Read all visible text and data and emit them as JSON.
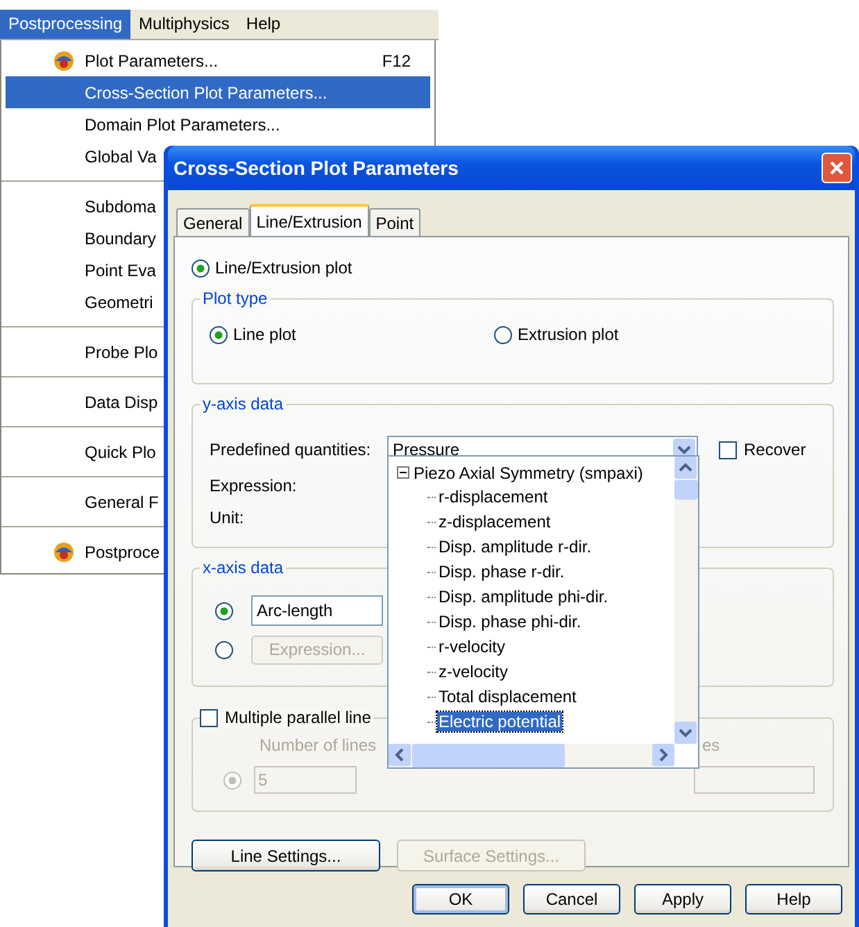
{
  "menu_bar": [
    {
      "label": "Postprocessing",
      "selected": true
    },
    {
      "label": "Multiphysics",
      "selected": false
    },
    {
      "label": "Help",
      "selected": false
    }
  ],
  "menu": [
    {
      "kind": "icon_item",
      "label": "Plot Parameters...",
      "shortcut": "F12",
      "selected": false
    },
    {
      "kind": "item",
      "label": "Cross-Section Plot Parameters...",
      "selected": true
    },
    {
      "kind": "item",
      "label": "Domain Plot Parameters...",
      "selected": false
    },
    {
      "kind": "item",
      "label": "Global Va",
      "selected": false
    },
    {
      "kind": "separator"
    },
    {
      "kind": "item",
      "label": "Subdoma",
      "selected": false
    },
    {
      "kind": "item",
      "label": "Boundary",
      "selected": false
    },
    {
      "kind": "item",
      "label": "Point Eva",
      "selected": false
    },
    {
      "kind": "item",
      "label": "Geometri",
      "selected": false
    },
    {
      "kind": "separator"
    },
    {
      "kind": "item",
      "label": "Probe Plo",
      "selected": false
    },
    {
      "kind": "separator"
    },
    {
      "kind": "item",
      "label": "Data Disp",
      "selected": false
    },
    {
      "kind": "separator"
    },
    {
      "kind": "item",
      "label": "Quick Plo",
      "selected": false
    },
    {
      "kind": "separator"
    },
    {
      "kind": "item",
      "label": "General F",
      "selected": false
    },
    {
      "kind": "separator"
    },
    {
      "kind": "icon_item",
      "label": "Postproce",
      "selected": false
    }
  ],
  "dialog": {
    "title": "Cross-Section Plot Parameters",
    "tabs": [
      {
        "label": "General",
        "selected": false
      },
      {
        "label": "Line/Extrusion",
        "selected": true
      },
      {
        "label": "Point",
        "selected": false
      }
    ],
    "mode": {
      "label": "Line/Extrusion plot",
      "selected": true
    },
    "plot_type": {
      "title": "Plot type",
      "options": [
        {
          "label": "Line plot",
          "selected": true
        },
        {
          "label": "Extrusion plot",
          "selected": false
        }
      ]
    },
    "y_axis": {
      "title": "y-axis data",
      "predefined_label": "Predefined quantities:",
      "predefined_value": "Pressure",
      "recover": {
        "label": "Recover",
        "checked": false
      },
      "expression_label": "Expression:",
      "unit_label": "Unit:"
    },
    "x_axis": {
      "title": "x-axis data",
      "options": [
        {
          "kind": "combo",
          "value": "Arc-length",
          "selected": true
        },
        {
          "kind": "button",
          "label": "Expression...",
          "selected": false
        }
      ]
    },
    "parallel": {
      "label": "Multiple parallel line",
      "checked": false,
      "number_label": "Number of lines",
      "number_value": "5",
      "radio_selected": true,
      "right_label": "es"
    },
    "dropdown_list": [
      {
        "label": "Piezo Axial Symmetry (smpaxi)",
        "expanded": true,
        "children": [
          {
            "label": "r-displacement",
            "selected": false
          },
          {
            "label": "z-displacement",
            "selected": false
          },
          {
            "label": "Disp. amplitude r-dir.",
            "selected": false
          },
          {
            "label": "Disp. phase r-dir.",
            "selected": false
          },
          {
            "label": "Disp. amplitude phi-dir.",
            "selected": false
          },
          {
            "label": "Disp. phase phi-dir.",
            "selected": false
          },
          {
            "label": "r-velocity",
            "selected": false
          },
          {
            "label": "z-velocity",
            "selected": false
          },
          {
            "label": "Total displacement",
            "selected": false
          },
          {
            "label": "Electric potential",
            "selected": true
          }
        ]
      }
    ],
    "settings_buttons": [
      {
        "label": "Line Settings...",
        "disabled": false
      },
      {
        "label": "Surface Settings...",
        "disabled": true
      }
    ],
    "footer_buttons": [
      {
        "label": "OK",
        "default": true
      },
      {
        "label": "Cancel",
        "default": false
      },
      {
        "label": "Apply",
        "default": false
      },
      {
        "label": "Help",
        "default": false
      }
    ]
  }
}
